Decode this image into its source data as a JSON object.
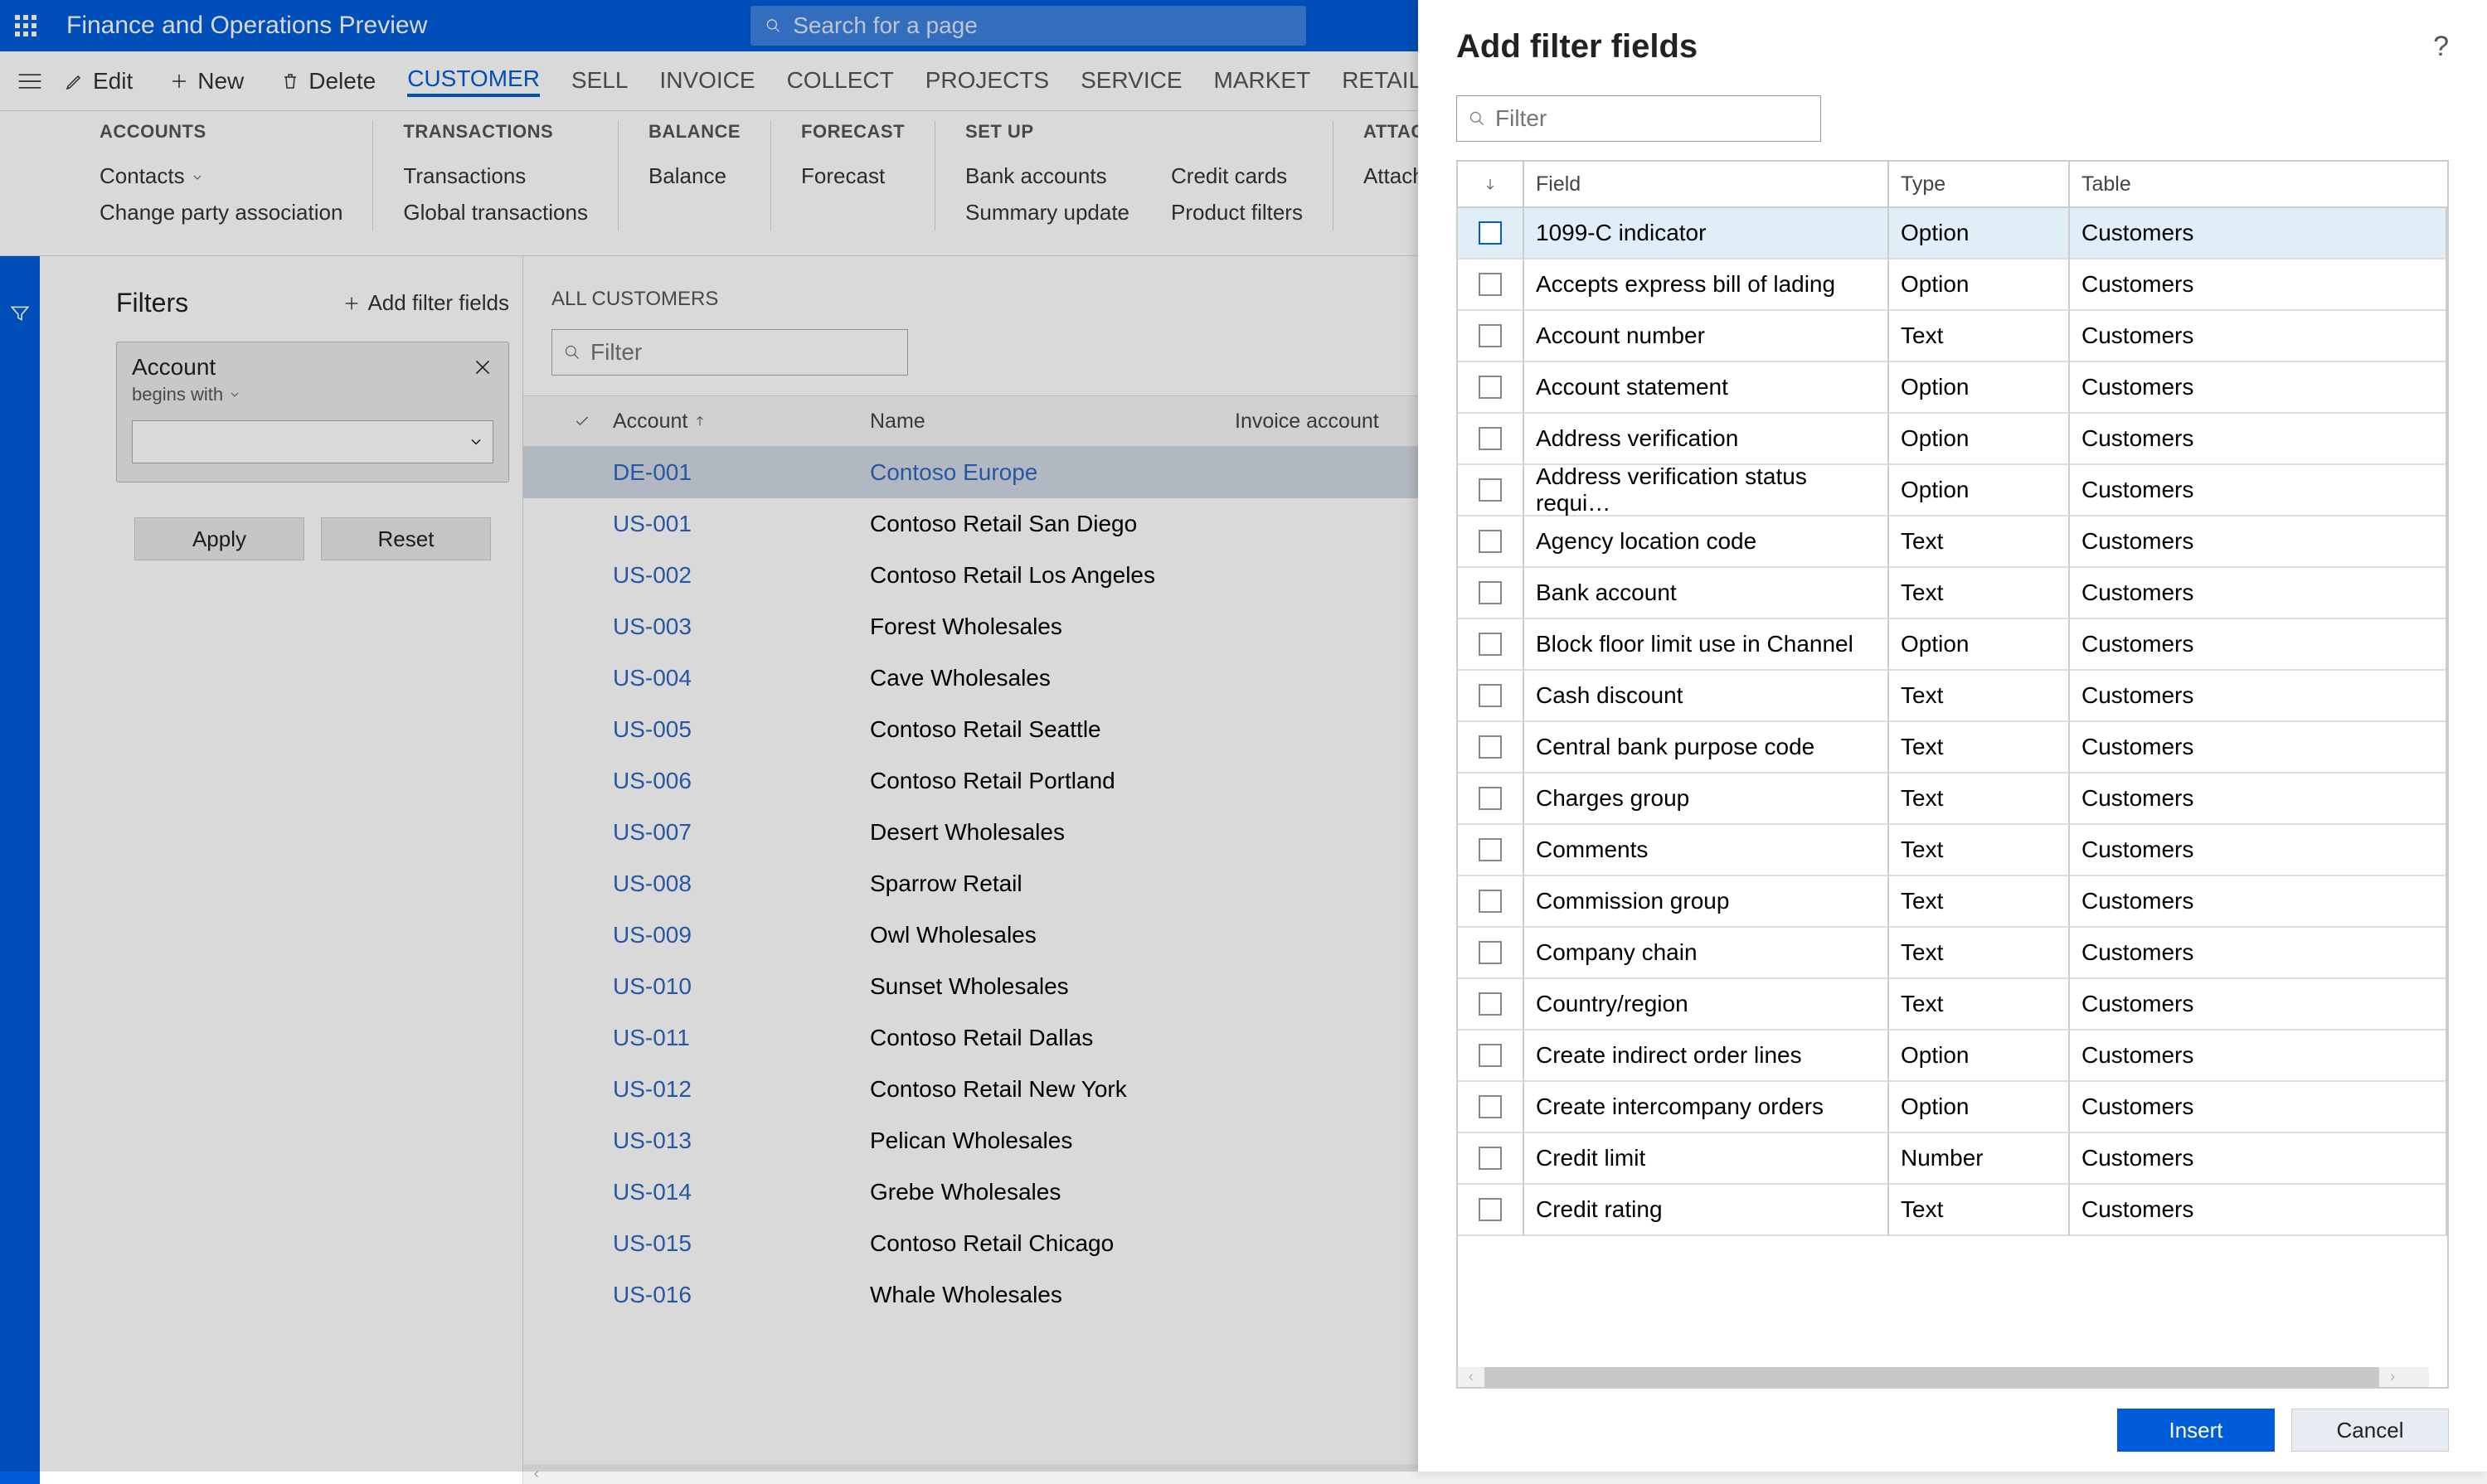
{
  "header": {
    "title": "Finance and Operations Preview",
    "search_placeholder": "Search for a page"
  },
  "actions": {
    "edit": "Edit",
    "new": "New",
    "delete": "Delete"
  },
  "tabs": [
    "CUSTOMER",
    "SELL",
    "INVOICE",
    "COLLECT",
    "PROJECTS",
    "SERVICE",
    "MARKET",
    "RETAIL"
  ],
  "ribbon": {
    "accounts": {
      "head": "ACCOUNTS",
      "items": [
        "Contacts",
        "Change party association"
      ]
    },
    "transactions": {
      "head": "TRANSACTIONS",
      "items": [
        "Transactions",
        "Global transactions"
      ]
    },
    "balance": {
      "head": "BALANCE",
      "items": [
        "Balance"
      ]
    },
    "forecast": {
      "head": "FORECAST",
      "items": [
        "Forecast"
      ]
    },
    "setup": {
      "head": "SET UP",
      "items": [
        "Bank accounts",
        "Summary update"
      ],
      "items2": [
        "Credit cards",
        "Product filters"
      ]
    },
    "attachments": {
      "head": "ATTACHMENTS",
      "items": [
        "Attachments"
      ]
    }
  },
  "filters": {
    "title": "Filters",
    "add": "Add filter fields",
    "card_title": "Account",
    "card_sub": "begins with",
    "apply": "Apply",
    "reset": "Reset"
  },
  "grid": {
    "title": "ALL CUSTOMERS",
    "filter_placeholder": "Filter",
    "cols": {
      "account": "Account",
      "name": "Name",
      "invoice": "Invoice account"
    },
    "rows": [
      {
        "acc": "DE-001",
        "name": "Contoso Europe",
        "selected": true
      },
      {
        "acc": "US-001",
        "name": "Contoso Retail San Diego"
      },
      {
        "acc": "US-002",
        "name": "Contoso Retail Los Angeles"
      },
      {
        "acc": "US-003",
        "name": "Forest Wholesales"
      },
      {
        "acc": "US-004",
        "name": "Cave Wholesales"
      },
      {
        "acc": "US-005",
        "name": "Contoso Retail Seattle"
      },
      {
        "acc": "US-006",
        "name": "Contoso Retail Portland"
      },
      {
        "acc": "US-007",
        "name": "Desert Wholesales"
      },
      {
        "acc": "US-008",
        "name": "Sparrow Retail"
      },
      {
        "acc": "US-009",
        "name": "Owl Wholesales"
      },
      {
        "acc": "US-010",
        "name": "Sunset Wholesales"
      },
      {
        "acc": "US-011",
        "name": "Contoso Retail Dallas"
      },
      {
        "acc": "US-012",
        "name": "Contoso Retail New York"
      },
      {
        "acc": "US-013",
        "name": "Pelican Wholesales"
      },
      {
        "acc": "US-014",
        "name": "Grebe Wholesales"
      },
      {
        "acc": "US-015",
        "name": "Contoso Retail Chicago"
      },
      {
        "acc": "US-016",
        "name": "Whale Wholesales"
      }
    ]
  },
  "panel": {
    "title": "Add filter fields",
    "filter_placeholder": "Filter",
    "cols": {
      "field": "Field",
      "type": "Type",
      "table": "Table"
    },
    "insert": "Insert",
    "cancel": "Cancel",
    "rows": [
      {
        "field": "1099-C indicator",
        "type": "Option",
        "table": "Customers",
        "selected": true
      },
      {
        "field": "Accepts express bill of lading",
        "type": "Option",
        "table": "Customers"
      },
      {
        "field": "Account number",
        "type": "Text",
        "table": "Customers"
      },
      {
        "field": "Account statement",
        "type": "Option",
        "table": "Customers"
      },
      {
        "field": "Address verification",
        "type": "Option",
        "table": "Customers"
      },
      {
        "field": "Address verification status requi…",
        "type": "Option",
        "table": "Customers"
      },
      {
        "field": "Agency location code",
        "type": "Text",
        "table": "Customers"
      },
      {
        "field": "Bank account",
        "type": "Text",
        "table": "Customers"
      },
      {
        "field": "Block floor limit use in Channel",
        "type": "Option",
        "table": "Customers"
      },
      {
        "field": "Cash discount",
        "type": "Text",
        "table": "Customers"
      },
      {
        "field": "Central bank purpose code",
        "type": "Text",
        "table": "Customers"
      },
      {
        "field": "Charges group",
        "type": "Text",
        "table": "Customers"
      },
      {
        "field": "Comments",
        "type": "Text",
        "table": "Customers"
      },
      {
        "field": "Commission group",
        "type": "Text",
        "table": "Customers"
      },
      {
        "field": "Company chain",
        "type": "Text",
        "table": "Customers"
      },
      {
        "field": "Country/region",
        "type": "Text",
        "table": "Customers"
      },
      {
        "field": "Create indirect order lines",
        "type": "Option",
        "table": "Customers"
      },
      {
        "field": "Create intercompany orders",
        "type": "Option",
        "table": "Customers"
      },
      {
        "field": "Credit limit",
        "type": "Number",
        "table": "Customers"
      },
      {
        "field": "Credit rating",
        "type": "Text",
        "table": "Customers"
      }
    ]
  }
}
